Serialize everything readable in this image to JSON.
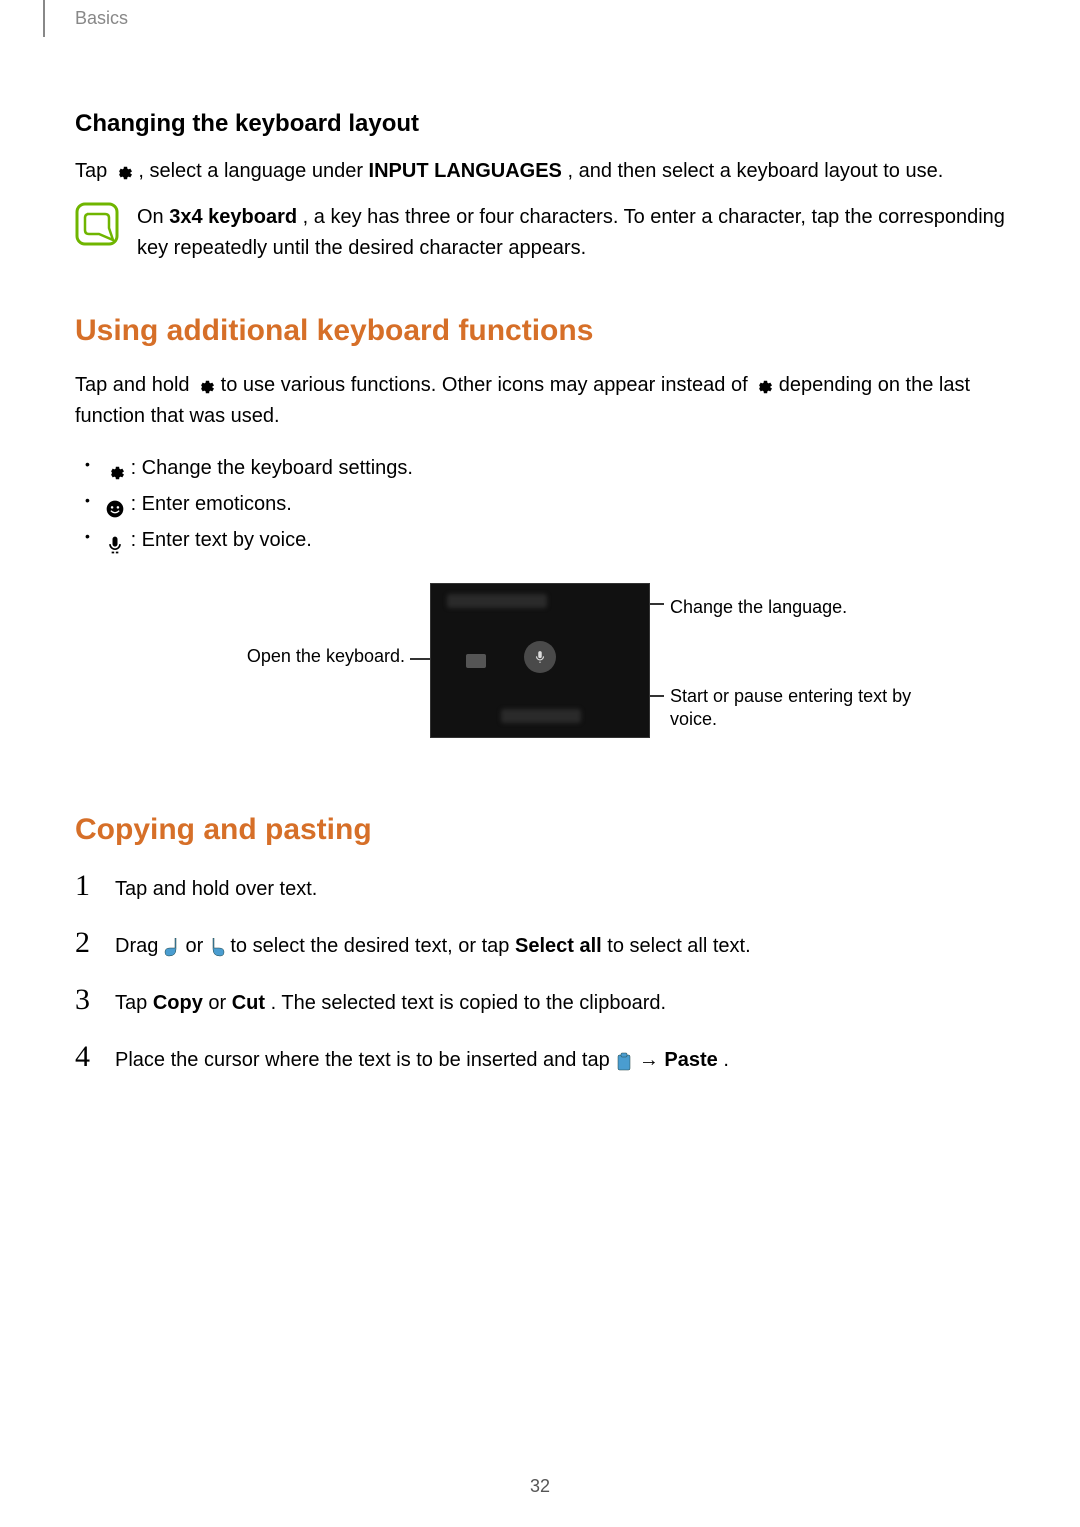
{
  "header": {
    "breadcrumb": "Basics"
  },
  "section1": {
    "heading": "Changing the keyboard layout",
    "text_before_gear": "Tap ",
    "text_after_gear": ", select a language under ",
    "bold1": "INPUT LANGUAGES",
    "text_after_bold1": ", and then select a keyboard layout to use."
  },
  "note1": {
    "text_before": "On ",
    "bold": "3x4 keyboard",
    "text_after": ", a key has three or four characters. To enter a character, tap the corresponding key repeatedly until the desired character appears."
  },
  "section2": {
    "heading": "Using additional keyboard functions",
    "text_before_gear1": "Tap and hold ",
    "text_mid": " to use various functions. Other icons may appear instead of ",
    "text_after_gear2": " depending on the last function that was used.",
    "bullets": {
      "b1": " : Change the keyboard settings.",
      "b2": " : Enter emoticons.",
      "b3": " : Enter text by voice."
    }
  },
  "diagram": {
    "left_label": "Open the keyboard.",
    "right_label1": "Change the language.",
    "right_label2": "Start or pause entering text by voice."
  },
  "section3": {
    "heading": "Copying and pasting",
    "step1": "Tap and hold over text.",
    "step2_a": "Drag ",
    "step2_b": " or ",
    "step2_c": " to select the desired text, or tap ",
    "step2_bold": "Select all",
    "step2_d": " to select all text.",
    "step3_a": "Tap ",
    "step3_bold1": "Copy",
    "step3_b": " or ",
    "step3_bold2": "Cut",
    "step3_c": ". The selected text is copied to the clipboard.",
    "step4_a": "Place the cursor where the text is to be inserted and tap ",
    "step4_arrow": " → ",
    "step4_bold": "Paste",
    "step4_b": "."
  },
  "page_number": "32"
}
